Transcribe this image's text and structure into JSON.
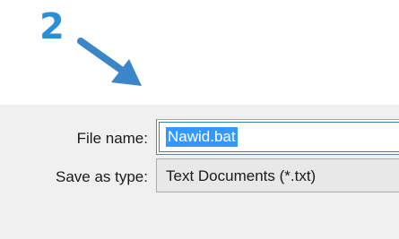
{
  "annotation": {
    "step_number": "2",
    "arrow_color": "#3a86c8",
    "number_color": "#2a8fd6"
  },
  "save_dialog": {
    "file_name_label": "File name:",
    "file_name_value": "Nawid.bat",
    "file_name_selected": true,
    "save_as_type_label": "Save as type:",
    "save_as_type_value": "Text Documents (*.txt)",
    "selection_color": "#3399ff",
    "background_color": "#f0f0f0"
  }
}
